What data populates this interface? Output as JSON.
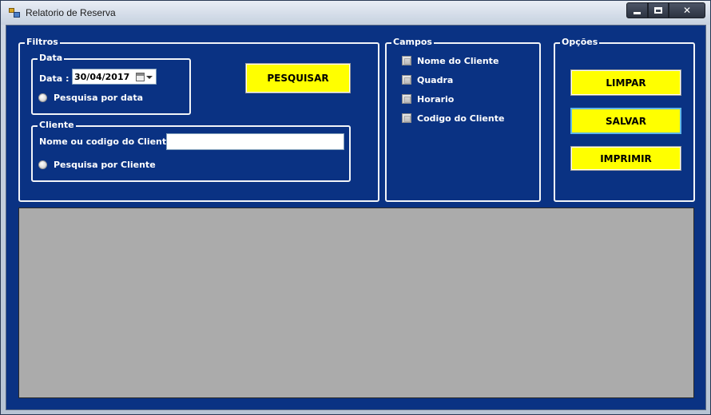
{
  "window": {
    "title": "Relatorio de Reserva"
  },
  "filtros": {
    "legend": "Filtros",
    "data_group": {
      "legend": "Data",
      "date_label": "Data :",
      "date_value": "30/04/2017",
      "radio_label": "Pesquisa por data"
    },
    "cliente_group": {
      "legend": "Cliente",
      "field_label": "Nome ou codigo do Cliente:",
      "field_value": "",
      "radio_label": "Pesquisa por Cliente"
    },
    "search_button": "PESQUISAR"
  },
  "campos": {
    "legend": "Campos",
    "options": [
      "Nome do Cliente",
      "Quadra",
      "Horario",
      "Codigo do Cliente"
    ]
  },
  "opcoes": {
    "legend": "Opções",
    "buttons": {
      "limpar": "LIMPAR",
      "salvar": "SALVAR",
      "imprimir": "IMPRIMIR"
    }
  },
  "colors": {
    "client_background": "#0a3283",
    "button_background": "#ffff00",
    "grid_background": "#ababab"
  }
}
